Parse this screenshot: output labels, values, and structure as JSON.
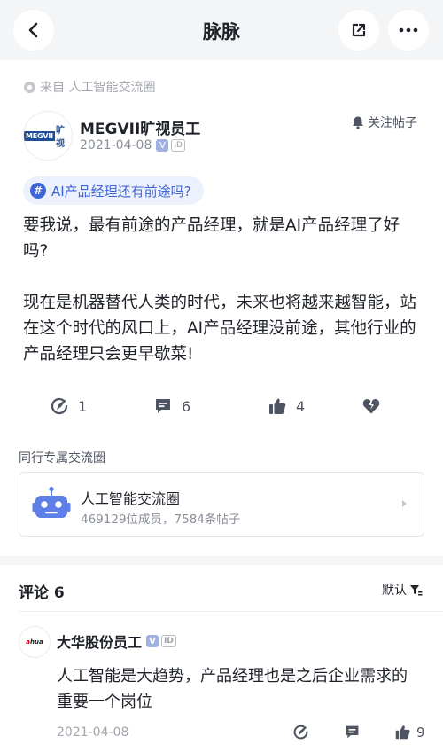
{
  "nav": {
    "title": "脉脉"
  },
  "source": {
    "text": "来自 人工智能交流圈"
  },
  "author": {
    "logo_box": "MEGVII",
    "logo_text": "旷视",
    "name": "MEGVII旷视员工",
    "date": "2021-04-08",
    "verified_badge": "V",
    "id_badge": "ID"
  },
  "follow": {
    "label": "关注帖子"
  },
  "topic": {
    "label": "AI产品经理还有前途吗?"
  },
  "post": {
    "paragraphs": [
      "要我说，最有前途的产品经理，就是AI产品经理了好吗?",
      "现在是机器替代人类的时代，未来也将越来越智能，站在这个时代的风口上，AI产品经理没前途，其他行业的产品经理只会更早歇菜!"
    ]
  },
  "actions": {
    "forward_count": "1",
    "comment_count": "6",
    "like_count": "4"
  },
  "circle": {
    "section_label": "同行专属交流圈",
    "name": "人工智能交流圈",
    "stats": "469129位成员，7584条帖子"
  },
  "comments": {
    "title": "评论 6",
    "sort_label": "默认",
    "items": [
      {
        "avatar_text_a": "a",
        "avatar_text_b": "hua",
        "author": "大华股份员工",
        "verified_badge": "V",
        "id_badge": "ID",
        "text": "人工智能是大趋势，产品经理也是之后企业需求的重要一个岗位",
        "date": "2021-04-08",
        "like_count": "9"
      }
    ]
  },
  "icons": [
    "back-icon",
    "share-icon",
    "more-icon",
    "location-icon",
    "bell-icon",
    "hash-icon",
    "forward-icon",
    "comment-icon",
    "like-icon",
    "dislike-icon",
    "robot-icon",
    "chevron-right-icon",
    "filter-icon"
  ],
  "colors": {
    "accent": "#3f66d6",
    "topic_bg": "#edf1fd",
    "page_bg": "#f4f5f7",
    "icon": "#4e5461",
    "muted": "#a3a7ae"
  }
}
